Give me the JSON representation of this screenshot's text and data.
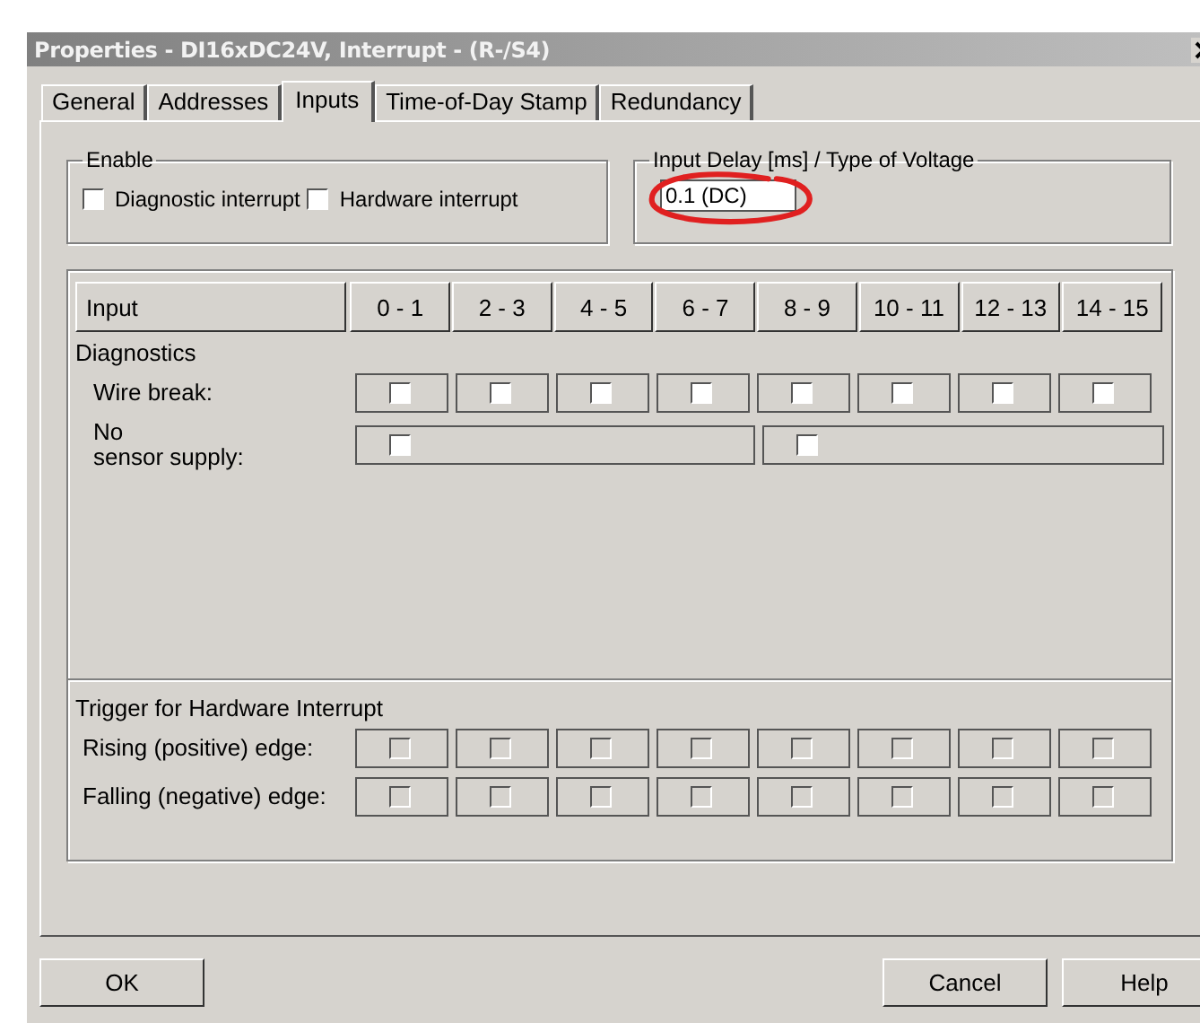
{
  "window": {
    "title": "Properties - DI16xDC24V, Interrupt - (R-/S4)"
  },
  "tabs": [
    {
      "label": "General",
      "selected": false
    },
    {
      "label": "Addresses",
      "selected": false
    },
    {
      "label": "Inputs",
      "selected": true
    },
    {
      "label": "Time-of-Day Stamp",
      "selected": false
    },
    {
      "label": "Redundancy",
      "selected": false
    }
  ],
  "enable": {
    "title": "Enable",
    "options": [
      {
        "label": "Diagnostic interrupt",
        "checked": false
      },
      {
        "label": "Hardware interrupt",
        "checked": false
      }
    ]
  },
  "delay": {
    "title": "Input Delay [ms] / Type of Voltage",
    "value": "0.1 (DC)",
    "annotation": {
      "kind": "ellipse"
    }
  },
  "table": {
    "columns": [
      "Input",
      "0 - 1",
      "2 - 3",
      "4 - 5",
      "6 - 7",
      "8 - 9",
      "10 - 11",
      "12 - 13",
      "14 - 15"
    ],
    "sections": [
      {
        "title": "Diagnostics",
        "rows": [
          {
            "label": "Wire break:",
            "kind": "pair",
            "cells": [
              {
                "checked": false,
                "disabled": false
              },
              {
                "checked": false,
                "disabled": false
              },
              {
                "checked": false,
                "disabled": false
              },
              {
                "checked": false,
                "disabled": false
              },
              {
                "checked": false,
                "disabled": false
              },
              {
                "checked": false,
                "disabled": false
              },
              {
                "checked": false,
                "disabled": false
              },
              {
                "checked": false,
                "disabled": false
              }
            ]
          },
          {
            "label": "No\nsensor supply:",
            "kind": "byte",
            "cells": [
              {
                "checked": false,
                "disabled": false
              },
              {
                "checked": false,
                "disabled": false
              }
            ]
          }
        ]
      },
      {
        "title": "Trigger for Hardware Interrupt",
        "rows": [
          {
            "label": "Rising (positive) edge:",
            "kind": "pair",
            "cells": [
              {
                "checked": false,
                "disabled": true
              },
              {
                "checked": false,
                "disabled": true
              },
              {
                "checked": false,
                "disabled": true
              },
              {
                "checked": false,
                "disabled": true
              },
              {
                "checked": false,
                "disabled": true
              },
              {
                "checked": false,
                "disabled": true
              },
              {
                "checked": false,
                "disabled": true
              },
              {
                "checked": false,
                "disabled": true
              }
            ]
          },
          {
            "label": "Falling (negative) edge:",
            "kind": "pair",
            "cells": [
              {
                "checked": false,
                "disabled": true
              },
              {
                "checked": false,
                "disabled": true
              },
              {
                "checked": false,
                "disabled": true
              },
              {
                "checked": false,
                "disabled": true
              },
              {
                "checked": false,
                "disabled": true
              },
              {
                "checked": false,
                "disabled": true
              },
              {
                "checked": false,
                "disabled": true
              },
              {
                "checked": false,
                "disabled": true
              }
            ]
          }
        ]
      }
    ]
  },
  "left_buttons": [
    {
      "label": "OK"
    }
  ],
  "right_buttons": [
    {
      "label": "Cancel"
    },
    {
      "label": "Help"
    }
  ]
}
